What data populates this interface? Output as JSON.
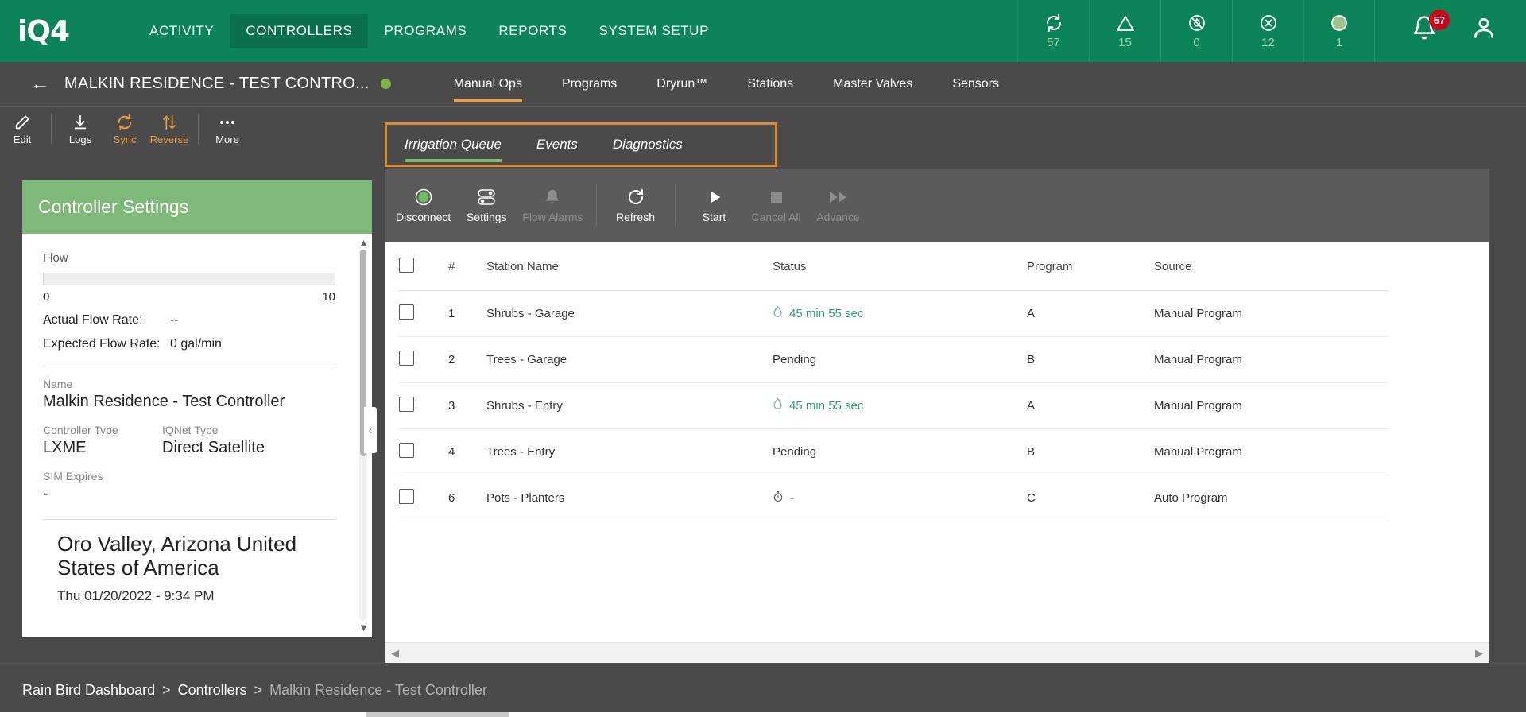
{
  "header": {
    "logo": "iQ4",
    "menu": [
      {
        "label": "ACTIVITY",
        "active": false
      },
      {
        "label": "CONTROLLERS",
        "active": true
      },
      {
        "label": "PROGRAMS",
        "active": false
      },
      {
        "label": "REPORTS",
        "active": false
      },
      {
        "label": "SYSTEM SETUP",
        "active": false
      }
    ],
    "status_icons": [
      {
        "icon": "sync-icon",
        "count": "57"
      },
      {
        "icon": "alert-triangle-icon",
        "count": "15"
      },
      {
        "icon": "no-water-icon",
        "count": "0"
      },
      {
        "icon": "error-circle-icon",
        "count": "12"
      },
      {
        "icon": "running-circle-icon",
        "count": "1"
      }
    ],
    "notification_badge": "57",
    "accent_green": "#0b8457",
    "badge_red": "#d0021b"
  },
  "controller_bar": {
    "back": "←",
    "title": "MALKIN RESIDENCE - TEST CONTRO...",
    "status_dot_color": "#7cb342",
    "tabs": [
      {
        "label": "Manual Ops",
        "active": true
      },
      {
        "label": "Programs",
        "active": false
      },
      {
        "label": "Dryrun™",
        "active": false
      },
      {
        "label": "Stations",
        "active": false
      },
      {
        "label": "Master Valves",
        "active": false
      },
      {
        "label": "Sensors",
        "active": false
      }
    ]
  },
  "left_toolbar": [
    {
      "label": "Edit",
      "icon": "pencil-icon",
      "color": "white"
    },
    {
      "label": "Logs",
      "icon": "download-icon",
      "color": "white"
    },
    {
      "label": "Sync",
      "icon": "sync-icon",
      "color": "orange"
    },
    {
      "label": "Reverse",
      "icon": "reverse-arrows-icon",
      "color": "orange"
    },
    {
      "label": "More",
      "icon": "ellipsis-icon",
      "color": "white"
    }
  ],
  "sub_tabs": [
    {
      "label": "Irrigation Queue",
      "active": true
    },
    {
      "label": "Events",
      "active": false
    },
    {
      "label": "Diagnostics",
      "active": false
    }
  ],
  "sub_tabs_highlight_color": "#e08a2e",
  "controller_settings": {
    "panel_title": "Controller Settings",
    "flow_label": "Flow",
    "flow_min": "0",
    "flow_max": "10",
    "actual_flow_label": "Actual Flow Rate:",
    "actual_flow_value": "--",
    "expected_flow_label": "Expected Flow Rate:",
    "expected_flow_value": "0 gal/min",
    "name_label": "Name",
    "name_value": "Malkin Residence - Test Controller",
    "controller_type_label": "Controller Type",
    "controller_type_value": "LXME",
    "iqnet_type_label": "IQNet Type",
    "iqnet_type_value": "Direct Satellite",
    "sim_expires_label": "SIM Expires",
    "sim_expires_value": "-",
    "location": "Oro Valley, Arizona United States of America",
    "local_time": "Thu 01/20/2022 - 9:34 PM"
  },
  "action_bar": [
    {
      "label": "Disconnect",
      "icon": "connected-circle-icon",
      "disabled": false
    },
    {
      "label": "Settings",
      "icon": "toggles-icon",
      "disabled": false
    },
    {
      "label": "Flow Alarms",
      "icon": "bell-icon",
      "disabled": true
    },
    {
      "label": "Refresh",
      "icon": "refresh-icon",
      "disabled": false
    },
    {
      "label": "Start",
      "icon": "play-icon",
      "disabled": false
    },
    {
      "label": "Cancel All",
      "icon": "stop-icon",
      "disabled": true
    },
    {
      "label": "Advance",
      "icon": "fast-forward-icon",
      "disabled": true
    }
  ],
  "table": {
    "columns": [
      "",
      "#",
      "Station Name",
      "Status",
      "Program",
      "Source"
    ],
    "rows": [
      {
        "num": "1",
        "station": "Shrubs - Garage",
        "status": "45 min 55 sec",
        "status_icon": "water-drop-icon",
        "program": "A",
        "source": "Manual Program"
      },
      {
        "num": "2",
        "station": "Trees - Garage",
        "status": "Pending",
        "status_icon": "",
        "program": "B",
        "source": "Manual Program"
      },
      {
        "num": "3",
        "station": "Shrubs - Entry",
        "status": "45 min 55 sec",
        "status_icon": "water-drop-icon",
        "program": "A",
        "source": "Manual Program"
      },
      {
        "num": "4",
        "station": "Trees - Entry",
        "status": "Pending",
        "status_icon": "",
        "program": "B",
        "source": "Manual Program"
      },
      {
        "num": "6",
        "station": "Pots - Planters",
        "status": "-",
        "status_icon": "clock-icon",
        "program": "C",
        "source": "Auto Program"
      }
    ]
  },
  "breadcrumb": {
    "root": "Rain Bird Dashboard",
    "sep1": ">",
    "level2": "Controllers",
    "sep2": ">",
    "current": "Malkin Residence - Test Controller"
  }
}
